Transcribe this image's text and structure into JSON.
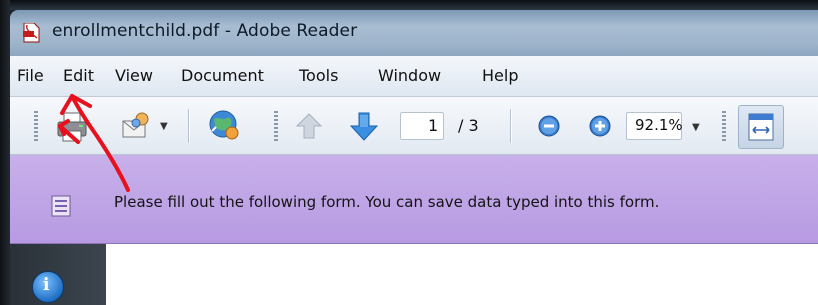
{
  "window": {
    "title": "enrollmentchild.pdf - Adobe Reader",
    "icon": "pdf-document-icon"
  },
  "menubar": {
    "items": [
      "File",
      "Edit",
      "View",
      "Document",
      "Tools",
      "Window",
      "Help"
    ]
  },
  "toolbar": {
    "icons": [
      "print-icon",
      "email-icon",
      "share-icon",
      "previous-page-icon",
      "next-page-icon",
      "zoom-out-icon",
      "zoom-in-icon",
      "fit-width-icon"
    ],
    "current_page": "1",
    "page_total": "/ 3",
    "zoom": "92.1%"
  },
  "notice": {
    "icon": "form-icon",
    "text": "Please fill out the following form. You can save data typed into this form."
  },
  "navigation": {
    "icons": [
      "info-icon"
    ],
    "info_glyph": "i"
  },
  "annotation": {
    "color": "#e8101c",
    "type": "red-arrows-pointing-to-file-menu"
  }
}
